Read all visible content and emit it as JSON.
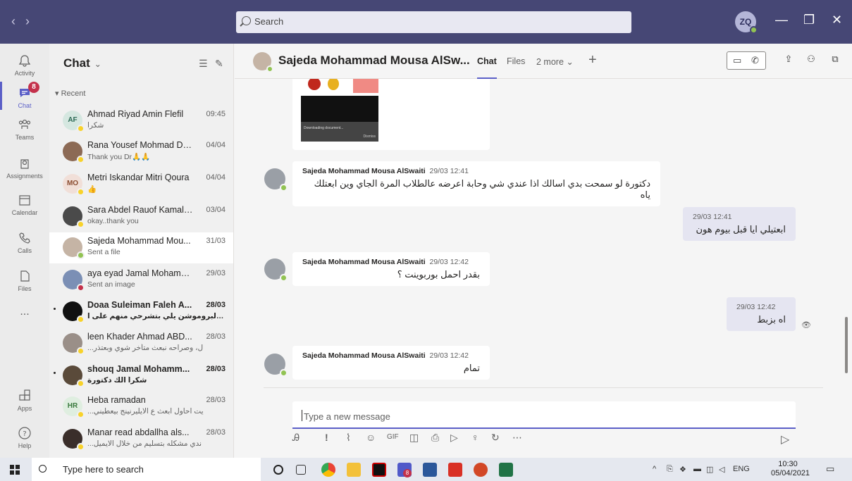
{
  "titlebar": {
    "nav_back": "‹",
    "nav_forward": "›",
    "search_placeholder": "Search",
    "me_initials": "ZQ",
    "minimize": "—",
    "maximize": "❐",
    "close": "✕"
  },
  "rail": {
    "items": [
      {
        "label": "Activity",
        "icon": "bell-icon"
      },
      {
        "label": "Chat",
        "icon": "chat-icon",
        "badge": "8"
      },
      {
        "label": "Teams",
        "icon": "teams-icon"
      },
      {
        "label": "Assignments",
        "icon": "assignments-icon"
      },
      {
        "label": "Calendar",
        "icon": "calendar-icon"
      },
      {
        "label": "Calls",
        "icon": "phone-icon"
      },
      {
        "label": "Files",
        "icon": "file-icon"
      },
      {
        "label": "...",
        "icon": "more-icon"
      },
      {
        "label": "Apps",
        "icon": "apps-icon"
      },
      {
        "label": "Help",
        "icon": "help-icon"
      }
    ]
  },
  "chatlist": {
    "title": "Chat",
    "section": "Recent",
    "items": [
      {
        "initials": "AF",
        "name": "Ahmad Riyad Amin Flefil",
        "time": "09:45",
        "preview": "شكرا",
        "status": "away"
      },
      {
        "initials": "",
        "name": "Rana Yousef Mohmad Da...",
        "time": "04/04",
        "preview": "Thank you Dr🙏🙏",
        "status": "away"
      },
      {
        "initials": "MO",
        "name": "Metri Iskandar Mitri Qoura",
        "time": "04/04",
        "preview": "👍",
        "status": "away"
      },
      {
        "initials": "",
        "name": "Sara Abdel Rauof Kamal ...",
        "time": "03/04",
        "preview": "okay..thank you",
        "status": "away"
      },
      {
        "initials": "",
        "name": "Sajeda Mohammad Mou...",
        "time": "31/03",
        "preview": "Sent a file",
        "status": "online"
      },
      {
        "initials": "",
        "name": "aya eyad Jamal Mohamm...",
        "time": "29/03",
        "preview": "Sent an image",
        "status": "busy"
      },
      {
        "initials": "",
        "name": "Doaa Suleiman Faleh A...",
        "time": "28/03",
        "preview": "البروموشن يلي بتشرحي منهم على ا...",
        "status": "away",
        "unread": true
      },
      {
        "initials": "",
        "name": "leen Khader Ahmad ABD...",
        "time": "28/03",
        "preview": "...ل، وصراحه نبعث متأخر شوي وبعتذر",
        "status": "away"
      },
      {
        "initials": "",
        "name": "shouq Jamal Mohamm...",
        "time": "28/03",
        "preview": "شكراً الك دكتورة",
        "status": "away",
        "unread": true
      },
      {
        "initials": "HR",
        "name": "Heba ramadan",
        "time": "28/03",
        "preview": "...يت احاول ابعث ع الايليرنينج بيعطيني",
        "status": "away"
      },
      {
        "initials": "",
        "name": "Manar read abdallha als...",
        "time": "28/03",
        "preview": "...ندي مشكله بتسليم من خلال الايميل",
        "status": "away"
      }
    ]
  },
  "conversation": {
    "name": "Sajeda Mohammad Mousa AlSw...",
    "tabs": [
      "Chat",
      "Files",
      "2 more ⌄"
    ],
    "attachment": {
      "download_text": "Downloading document...",
      "dismiss": "Dismiss"
    },
    "messages": [
      {
        "sender": "Sajeda Mohammad Mousa AlSwaiti",
        "time": "29/03 12:41",
        "text": "دكتورة لو سمحت بدي اسالك اذا عندي شي وحابة اعرضه عالطلاب المرة الجاي وين ابعتلك ياه",
        "mine": false
      },
      {
        "sender": "",
        "time": "29/03 12:41",
        "text": "ابعتيلي ايا قبل بيوم هون",
        "mine": true
      },
      {
        "sender": "Sajeda Mohammad Mousa AlSwaiti",
        "time": "29/03 12:42",
        "text": "بقدر احمل بوربوينت ؟",
        "mine": false
      },
      {
        "sender": "",
        "time": "29/03 12:42",
        "text": "اه بزبط",
        "mine": true
      },
      {
        "sender": "Sajeda Mohammad Mousa AlSwaiti",
        "time": "29/03 12:42",
        "text": "تمام",
        "mine": false
      }
    ],
    "compose_placeholder": "Type a new message"
  },
  "taskbar": {
    "search_placeholder": "Type here to search",
    "language": "ENG",
    "time": "10:30",
    "date": "05/04/2021",
    "teams_badge": "8"
  },
  "colors": {
    "brand": "#464775",
    "accent": "#5b5fc7",
    "online": "#92c353",
    "away": "#f8d22a",
    "busy": "#c4314b"
  }
}
